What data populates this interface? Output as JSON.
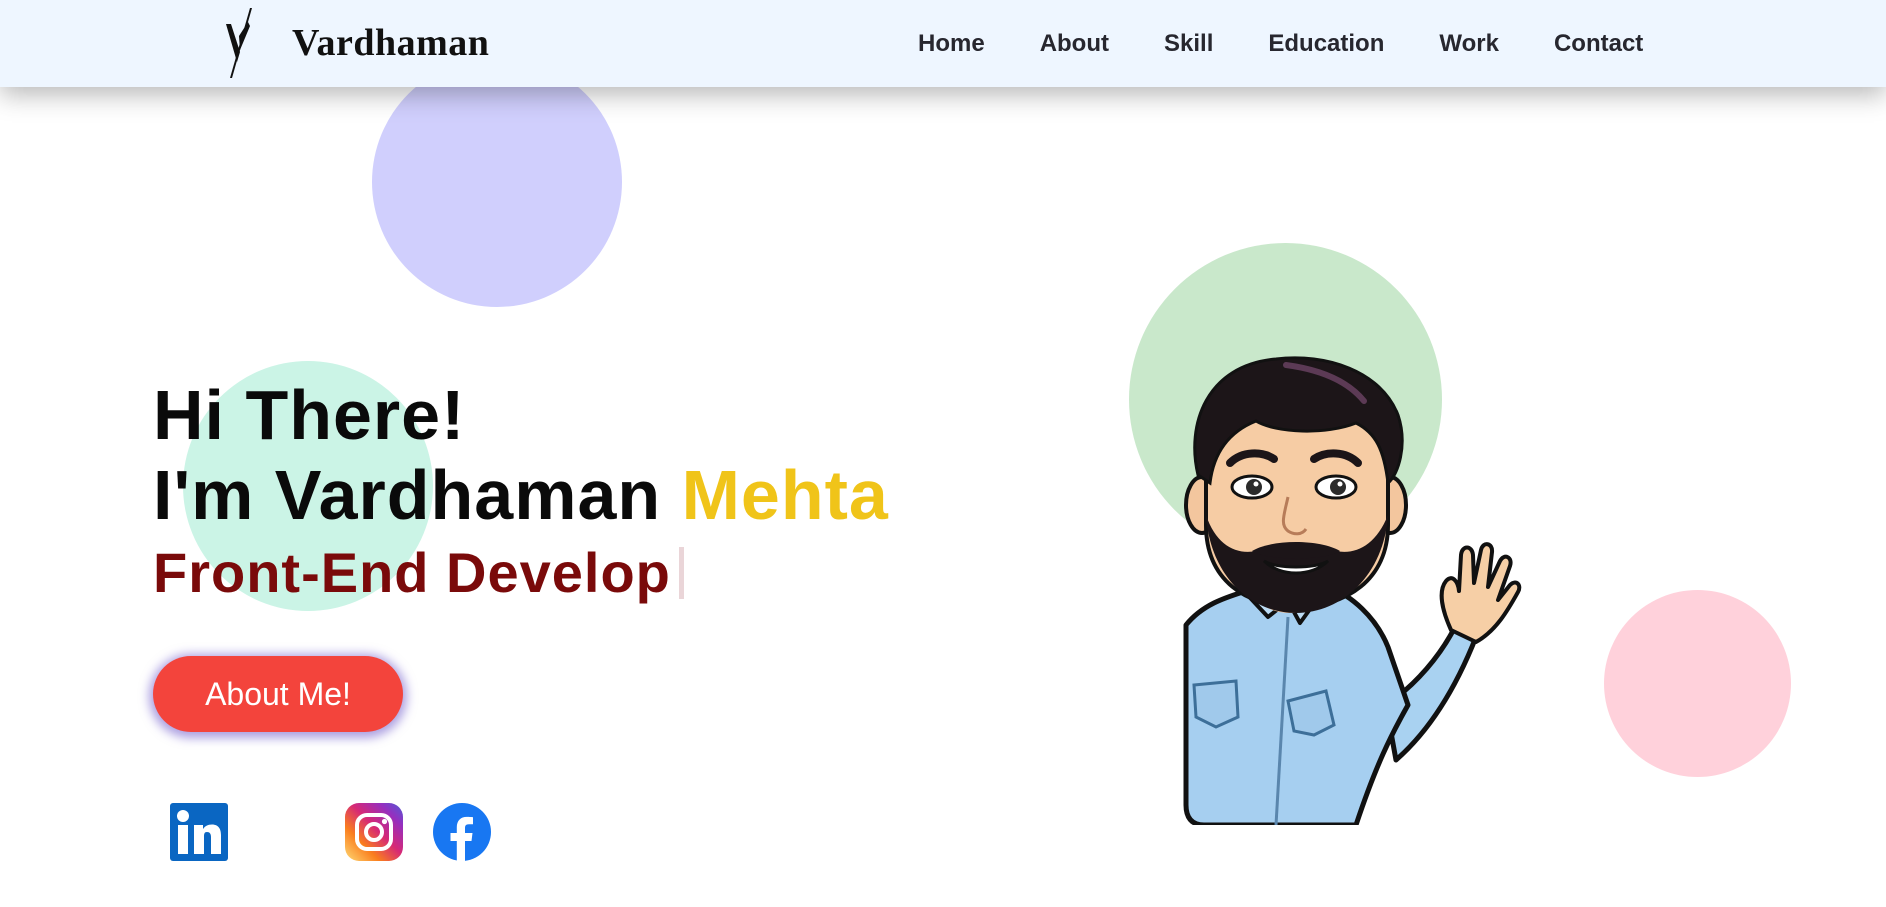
{
  "brand": {
    "name": "Vardhaman",
    "logo_icon": "v-slash-logo-icon"
  },
  "nav": {
    "items": [
      {
        "label": "Home"
      },
      {
        "label": "About"
      },
      {
        "label": "Skill"
      },
      {
        "label": "Education"
      },
      {
        "label": "Work"
      },
      {
        "label": "Contact"
      }
    ]
  },
  "hero": {
    "greeting": "Hi There!",
    "intro_prefix": "I'm Vardhaman ",
    "intro_highlight": "Mehta",
    "typed_role": "Front-End Develop",
    "cta_label": "About Me!"
  },
  "social": [
    {
      "icon": "linkedin-icon"
    },
    {
      "icon": "instagram-icon"
    },
    {
      "icon": "facebook-icon"
    }
  ],
  "colors": {
    "nav_bg": "#eef6ff",
    "highlight": "#f0c419",
    "role_text": "#7a0a0a",
    "cta_bg": "#f3443c",
    "circle_purple": "#d0cffd",
    "circle_mint": "#cbf4e6",
    "circle_green": "#c9e8cb",
    "circle_pink": "#ffd1db"
  }
}
